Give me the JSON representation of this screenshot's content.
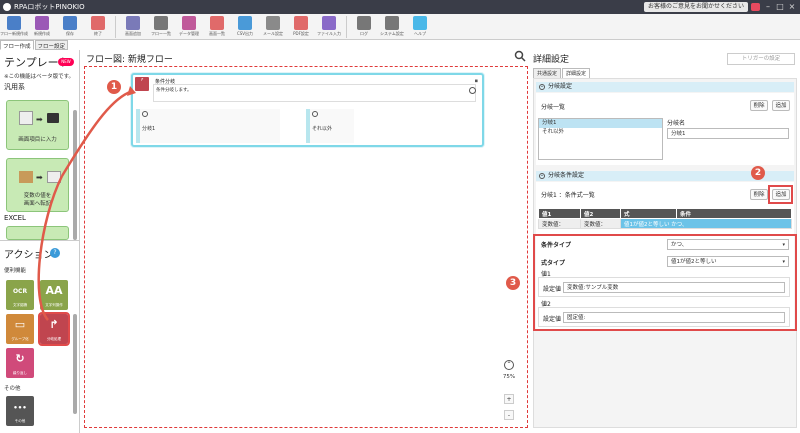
{
  "titlebar": {
    "app_name": "RPAロボットPINOKIO",
    "feedback": "お客様のご意見をお聞かせください",
    "min": "–",
    "max": "□",
    "close": "×"
  },
  "toolbar": {
    "items": [
      {
        "label": "フロー新規作成",
        "color": "#4a7fc8"
      },
      {
        "label": "新規作成",
        "color": "#9b59b6"
      },
      {
        "label": "保存",
        "color": "#4a7fc8"
      },
      {
        "label": "終了",
        "color": "#e06a6a"
      },
      {
        "label": "画面追加",
        "color": "#7a7ab8"
      },
      {
        "label": "フロー一覧",
        "color": "#777777"
      },
      {
        "label": "データ管理",
        "color": "#c05a9a"
      },
      {
        "label": "画面一覧",
        "color": "#e06a6a"
      },
      {
        "label": "CSV出力",
        "color": "#4a9ad8"
      },
      {
        "label": "メール設定",
        "color": "#8a8a8a"
      },
      {
        "label": "PDF設定",
        "color": "#e06a6a"
      },
      {
        "label": "ファイル入力",
        "color": "#8a6ac8"
      },
      {
        "label": "ログ",
        "color": "#777777"
      },
      {
        "label": "システム設定",
        "color": "#777777"
      },
      {
        "label": "ヘルプ",
        "color": "#4ab8e8"
      }
    ]
  },
  "left": {
    "tabs": [
      "フロー作成",
      "フロー設定"
    ],
    "title": "テンプレート",
    "note": "※この機能はベータ版です。",
    "cat1": "汎用系",
    "card1": "画面項目に入力",
    "card2_l1": "変数の値を",
    "card2_l2": "画面へ転記",
    "cat2": "EXCEL",
    "actions_title": "アクション",
    "actions_sub": "便利機能",
    "tiles": [
      {
        "label": "文字認識",
        "glyph": "OCR",
        "color": "#8aa44a"
      },
      {
        "label": "文字列操作",
        "glyph": "AA",
        "color": "#8aa44a"
      },
      {
        "label": "グループ化",
        "glyph": "▭",
        "color": "#d0893a"
      },
      {
        "label": "分岐処理",
        "glyph": "↱",
        "color": "#c0454f"
      },
      {
        "label": "繰り返し",
        "glyph": "↻",
        "color": "#d04a7a"
      },
      {
        "label": "その他",
        "glyph": "•••",
        "color": "#555555"
      }
    ],
    "other_label": "その他"
  },
  "canvas": {
    "header": "フロー図:  新規フロー",
    "node_title": "条件分岐",
    "node_desc": "条件分岐します。",
    "branch1": "分岐1",
    "branch2": "それ以外",
    "zoom_pct": "75%",
    "zoom_in": "+",
    "zoom_out": "-"
  },
  "right": {
    "header": "詳細設定",
    "trigger": "トリガーの設定",
    "tabs": [
      "共通設定",
      "詳細設定"
    ],
    "sec1": "分岐設定",
    "branch_list_label": "分岐一覧",
    "branch_name_label": "分岐名",
    "delete": "削除",
    "add": "追加",
    "branches": [
      "分岐1",
      "それ以外"
    ],
    "branch_name_value": "分岐1",
    "sec2": "分岐条件設定",
    "cond_title": "分岐1 ：条件式一覧",
    "table_headers": [
      "値1",
      "値2",
      "式",
      "条件"
    ],
    "table_row": [
      "変数値：",
      "変数値：",
      "値1が値2と等しい かつ、",
      ""
    ],
    "cond_type_label": "条件タイプ",
    "cond_type_value": "かつ、",
    "expr_type_label": "式タイプ",
    "expr_type_value": "値1が値2と等しい",
    "val1_label": "値1",
    "val2_label": "値2",
    "setting_label": "設定値",
    "val1_value": "変数値:サンプル変数",
    "val2_value": "固定値:"
  },
  "markers": [
    "1",
    "2",
    "3"
  ]
}
